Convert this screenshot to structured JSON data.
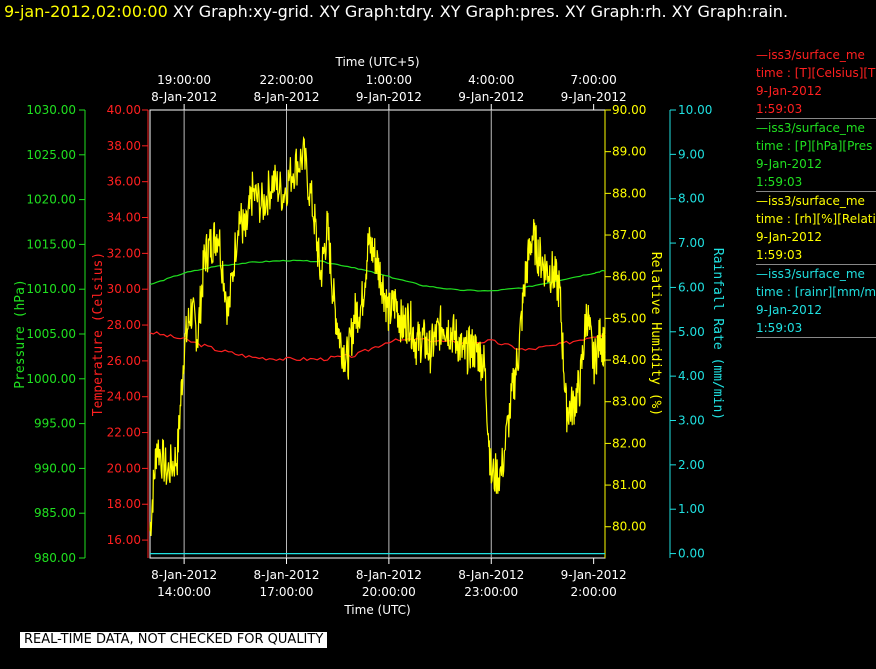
{
  "header": {
    "timestamp": "9-jan-2012,02:00:00",
    "graphs": "XY Graph:xy-grid.  XY Graph:tdry.  XY Graph:pres.  XY Graph:rh.  XY Graph:rain."
  },
  "legend": [
    {
      "line1": "—iss3/surface_me",
      "line2": "time : [T][Celsius][T",
      "line3": "9-Jan-2012",
      "line4": "1:59:03",
      "color": "#ff2020"
    },
    {
      "line1": "—iss3/surface_me",
      "line2": "time : [P][hPa][Pres",
      "line3": "9-Jan-2012",
      "line4": "1:59:03",
      "color": "#20e020"
    },
    {
      "line1": "—iss3/surface_me",
      "line2": "time : [rh][%][Relati",
      "line3": "9-Jan-2012",
      "line4": "1:59:03",
      "color": "#ffff00"
    },
    {
      "line1": "—iss3/surface_me",
      "line2": "time : [rainr][mm/mi",
      "line3": "9-Jan-2012",
      "line4": "1:59:03",
      "color": "#20e0e0"
    }
  ],
  "footer_note": "REAL-TIME DATA, NOT CHECKED FOR QUALITY",
  "chart_data": {
    "type": "line",
    "x_axis_bottom": {
      "title": "Time (UTC)",
      "range_hours": [
        13.0,
        26.333
      ],
      "ticks": [
        {
          "hour": 14,
          "date": "8-Jan-2012",
          "time": "14:00:00"
        },
        {
          "hour": 17,
          "date": "8-Jan-2012",
          "time": "17:00:00"
        },
        {
          "hour": 20,
          "date": "8-Jan-2012",
          "time": "20:00:00"
        },
        {
          "hour": 23,
          "date": "8-Jan-2012",
          "time": "23:00:00"
        },
        {
          "hour": 26,
          "date": "9-Jan-2012",
          "time": "2:00:00"
        }
      ]
    },
    "x_axis_top": {
      "title": "Time (UTC+5)",
      "ticks": [
        {
          "hour": 14,
          "date": "8-Jan-2012",
          "time": "19:00:00"
        },
        {
          "hour": 17,
          "date": "8-Jan-2012",
          "time": "22:00:00"
        },
        {
          "hour": 20,
          "date": "9-Jan-2012",
          "time": "1:00:00"
        },
        {
          "hour": 23,
          "date": "9-Jan-2012",
          "time": "4:00:00"
        },
        {
          "hour": 26,
          "date": "9-Jan-2012",
          "time": "7:00:00"
        }
      ]
    },
    "grid": true,
    "axes": {
      "pressure": {
        "title": "Pressure (hPa)",
        "range": [
          980,
          1030
        ],
        "ticks": [
          "980.00",
          "985.00",
          "990.00",
          "995.00",
          "1000.00",
          "1005.00",
          "1010.00",
          "1015.00",
          "1020.00",
          "1025.00",
          "1030.00"
        ],
        "color": "#20e020"
      },
      "temperature": {
        "title": "Temperature (Celsius)",
        "range": [
          15,
          40
        ],
        "ticks": [
          "16.00",
          "18.00",
          "20.00",
          "22.00",
          "24.00",
          "26.00",
          "28.00",
          "30.00",
          "32.00",
          "34.00",
          "36.00",
          "38.00",
          "40.00"
        ],
        "color": "#ff2020"
      },
      "rh": {
        "title": "Relative Humidity (%)",
        "range": [
          79.25,
          90
        ],
        "ticks": [
          "80.00",
          "81.00",
          "82.00",
          "83.00",
          "84.00",
          "85.00",
          "86.00",
          "87.00",
          "88.00",
          "89.00",
          "90.00"
        ],
        "color": "#ffff00"
      },
      "rain": {
        "title": "Rainfall Rate (mm/min)",
        "range": [
          -0.1,
          10
        ],
        "ticks": [
          "0.00",
          "1.00",
          "2.00",
          "3.00",
          "4.00",
          "5.00",
          "6.00",
          "7.00",
          "8.00",
          "9.00",
          "10.00"
        ],
        "color": "#20e0e0"
      }
    },
    "series": [
      {
        "axis": "temperature",
        "color": "#ff2020",
        "x": [
          13.0,
          14.0,
          15.0,
          16.0,
          17.0,
          18.0,
          19.0,
          20.0,
          21.0,
          22.0,
          23.0,
          24.0,
          25.0,
          26.0,
          26.333
        ],
        "y": [
          27.6,
          27.2,
          26.6,
          26.2,
          26.1,
          26.1,
          26.3,
          27.1,
          27.2,
          27.0,
          27.1,
          26.6,
          26.9,
          27.4,
          27.5
        ]
      },
      {
        "axis": "pressure",
        "color": "#20e020",
        "x": [
          13.0,
          14.0,
          15.0,
          16.0,
          17.0,
          18.0,
          19.0,
          20.0,
          21.0,
          22.0,
          23.0,
          24.0,
          25.0,
          26.0,
          26.333
        ],
        "y": [
          1010.5,
          1011.8,
          1012.6,
          1013.0,
          1013.2,
          1013.1,
          1012.4,
          1011.4,
          1010.4,
          1009.9,
          1009.8,
          1010.2,
          1011.0,
          1011.8,
          1012.1
        ]
      },
      {
        "axis": "rh",
        "color": "#ffff00",
        "x": [
          13.0,
          13.2,
          13.5,
          13.8,
          14.0,
          14.2,
          14.4,
          14.6,
          14.8,
          15.0,
          15.3,
          15.6,
          15.8,
          16.0,
          16.3,
          16.6,
          16.9,
          17.2,
          17.5,
          17.8,
          18.0,
          18.2,
          18.4,
          18.6,
          18.8,
          19.0,
          19.2,
          19.4,
          19.6,
          19.8,
          20.0,
          20.2,
          20.4,
          20.6,
          20.8,
          21.0,
          21.2,
          21.4,
          21.6,
          21.8,
          22.0,
          22.2,
          22.4,
          22.6,
          22.8,
          23.0,
          23.3,
          23.6,
          23.8,
          24.0,
          24.2,
          24.4,
          24.6,
          24.8,
          25.0,
          25.2,
          25.4,
          25.6,
          25.8,
          26.0,
          26.2,
          26.333
        ],
        "y": [
          79.9,
          82.0,
          81.3,
          81.7,
          84.3,
          85.2,
          84.6,
          86.5,
          86.8,
          87.1,
          85.1,
          87.5,
          87.0,
          88.0,
          87.7,
          88.3,
          88.0,
          88.6,
          88.9,
          87.5,
          86.0,
          87.2,
          85.3,
          84.4,
          84.0,
          85.1,
          85.3,
          86.8,
          86.5,
          85.9,
          85.1,
          85.4,
          84.8,
          85.0,
          84.4,
          84.5,
          84.2,
          84.6,
          84.9,
          84.7,
          84.5,
          84.1,
          84.3,
          84.2,
          83.9,
          81.2,
          81.3,
          83.1,
          84.2,
          86.0,
          87.0,
          86.5,
          86.2,
          86.1,
          85.7,
          82.8,
          82.9,
          83.4,
          85.2,
          83.9,
          84.6,
          84.2
        ]
      },
      {
        "axis": "rain",
        "color": "#20e0e0",
        "x": [
          13.0,
          26.333
        ],
        "y": [
          0.0,
          0.0
        ]
      }
    ]
  }
}
